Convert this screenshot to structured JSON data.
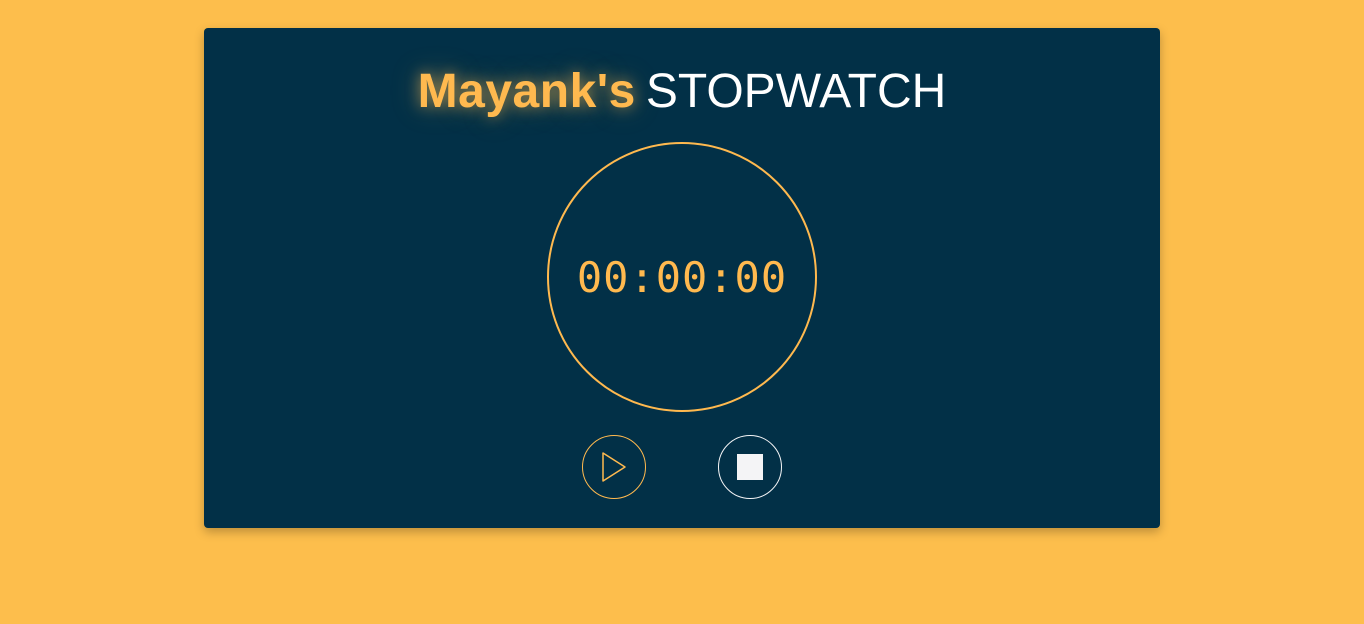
{
  "app": {
    "title_name": "Mayank's",
    "title_word": "STOPWATCH"
  },
  "timer": {
    "display": "00:00:00"
  },
  "controls": {
    "play_icon": "play-icon",
    "stop_icon": "stop-icon"
  },
  "colors": {
    "background": "#FDBE4C",
    "card": "#023047",
    "accent": "#FFB94F",
    "light": "#F4F4F6"
  }
}
